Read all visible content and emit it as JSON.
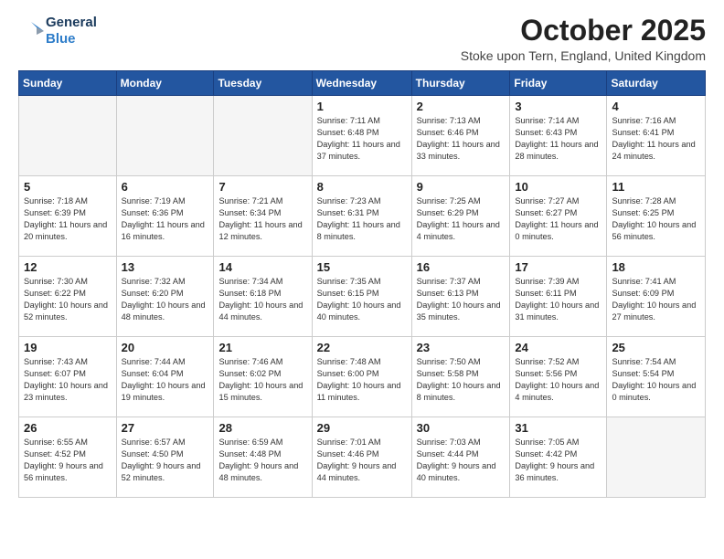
{
  "header": {
    "logo_general": "General",
    "logo_blue": "Blue",
    "month": "October 2025",
    "location": "Stoke upon Tern, England, United Kingdom"
  },
  "weekdays": [
    "Sunday",
    "Monday",
    "Tuesday",
    "Wednesday",
    "Thursday",
    "Friday",
    "Saturday"
  ],
  "weeks": [
    [
      {
        "day": "",
        "info": ""
      },
      {
        "day": "",
        "info": ""
      },
      {
        "day": "",
        "info": ""
      },
      {
        "day": "1",
        "info": "Sunrise: 7:11 AM\nSunset: 6:48 PM\nDaylight: 11 hours\nand 37 minutes."
      },
      {
        "day": "2",
        "info": "Sunrise: 7:13 AM\nSunset: 6:46 PM\nDaylight: 11 hours\nand 33 minutes."
      },
      {
        "day": "3",
        "info": "Sunrise: 7:14 AM\nSunset: 6:43 PM\nDaylight: 11 hours\nand 28 minutes."
      },
      {
        "day": "4",
        "info": "Sunrise: 7:16 AM\nSunset: 6:41 PM\nDaylight: 11 hours\nand 24 minutes."
      }
    ],
    [
      {
        "day": "5",
        "info": "Sunrise: 7:18 AM\nSunset: 6:39 PM\nDaylight: 11 hours\nand 20 minutes."
      },
      {
        "day": "6",
        "info": "Sunrise: 7:19 AM\nSunset: 6:36 PM\nDaylight: 11 hours\nand 16 minutes."
      },
      {
        "day": "7",
        "info": "Sunrise: 7:21 AM\nSunset: 6:34 PM\nDaylight: 11 hours\nand 12 minutes."
      },
      {
        "day": "8",
        "info": "Sunrise: 7:23 AM\nSunset: 6:31 PM\nDaylight: 11 hours\nand 8 minutes."
      },
      {
        "day": "9",
        "info": "Sunrise: 7:25 AM\nSunset: 6:29 PM\nDaylight: 11 hours\nand 4 minutes."
      },
      {
        "day": "10",
        "info": "Sunrise: 7:27 AM\nSunset: 6:27 PM\nDaylight: 11 hours\nand 0 minutes."
      },
      {
        "day": "11",
        "info": "Sunrise: 7:28 AM\nSunset: 6:25 PM\nDaylight: 10 hours\nand 56 minutes."
      }
    ],
    [
      {
        "day": "12",
        "info": "Sunrise: 7:30 AM\nSunset: 6:22 PM\nDaylight: 10 hours\nand 52 minutes."
      },
      {
        "day": "13",
        "info": "Sunrise: 7:32 AM\nSunset: 6:20 PM\nDaylight: 10 hours\nand 48 minutes."
      },
      {
        "day": "14",
        "info": "Sunrise: 7:34 AM\nSunset: 6:18 PM\nDaylight: 10 hours\nand 44 minutes."
      },
      {
        "day": "15",
        "info": "Sunrise: 7:35 AM\nSunset: 6:15 PM\nDaylight: 10 hours\nand 40 minutes."
      },
      {
        "day": "16",
        "info": "Sunrise: 7:37 AM\nSunset: 6:13 PM\nDaylight: 10 hours\nand 35 minutes."
      },
      {
        "day": "17",
        "info": "Sunrise: 7:39 AM\nSunset: 6:11 PM\nDaylight: 10 hours\nand 31 minutes."
      },
      {
        "day": "18",
        "info": "Sunrise: 7:41 AM\nSunset: 6:09 PM\nDaylight: 10 hours\nand 27 minutes."
      }
    ],
    [
      {
        "day": "19",
        "info": "Sunrise: 7:43 AM\nSunset: 6:07 PM\nDaylight: 10 hours\nand 23 minutes."
      },
      {
        "day": "20",
        "info": "Sunrise: 7:44 AM\nSunset: 6:04 PM\nDaylight: 10 hours\nand 19 minutes."
      },
      {
        "day": "21",
        "info": "Sunrise: 7:46 AM\nSunset: 6:02 PM\nDaylight: 10 hours\nand 15 minutes."
      },
      {
        "day": "22",
        "info": "Sunrise: 7:48 AM\nSunset: 6:00 PM\nDaylight: 10 hours\nand 11 minutes."
      },
      {
        "day": "23",
        "info": "Sunrise: 7:50 AM\nSunset: 5:58 PM\nDaylight: 10 hours\nand 8 minutes."
      },
      {
        "day": "24",
        "info": "Sunrise: 7:52 AM\nSunset: 5:56 PM\nDaylight: 10 hours\nand 4 minutes."
      },
      {
        "day": "25",
        "info": "Sunrise: 7:54 AM\nSunset: 5:54 PM\nDaylight: 10 hours\nand 0 minutes."
      }
    ],
    [
      {
        "day": "26",
        "info": "Sunrise: 6:55 AM\nSunset: 4:52 PM\nDaylight: 9 hours\nand 56 minutes."
      },
      {
        "day": "27",
        "info": "Sunrise: 6:57 AM\nSunset: 4:50 PM\nDaylight: 9 hours\nand 52 minutes."
      },
      {
        "day": "28",
        "info": "Sunrise: 6:59 AM\nSunset: 4:48 PM\nDaylight: 9 hours\nand 48 minutes."
      },
      {
        "day": "29",
        "info": "Sunrise: 7:01 AM\nSunset: 4:46 PM\nDaylight: 9 hours\nand 44 minutes."
      },
      {
        "day": "30",
        "info": "Sunrise: 7:03 AM\nSunset: 4:44 PM\nDaylight: 9 hours\nand 40 minutes."
      },
      {
        "day": "31",
        "info": "Sunrise: 7:05 AM\nSunset: 4:42 PM\nDaylight: 9 hours\nand 36 minutes."
      },
      {
        "day": "",
        "info": ""
      }
    ]
  ]
}
